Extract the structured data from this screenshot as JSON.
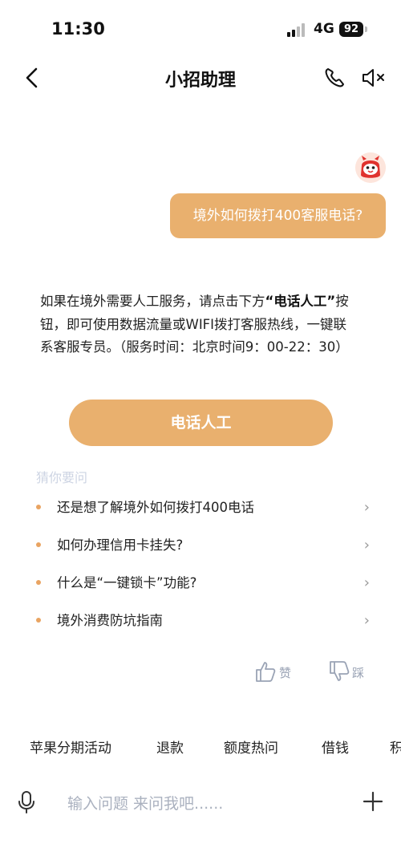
{
  "status_bar": {
    "time": "11:30",
    "network": "4G",
    "battery": "92"
  },
  "header": {
    "title": "小招助理"
  },
  "chat": {
    "user_message": "境外如何拨打400客服电话?",
    "answer_part1": "如果在境外需要人工服务，请点击下方",
    "answer_highlight": "“电话人工”",
    "answer_part2": "按钮，即可使用数据流量或WIFI拨打客服热线，一键联系客服专员。（服务时间：北京时间9：00-22：30）",
    "call_button": "电话人工"
  },
  "suggestions": {
    "title": "猜你要问",
    "items": [
      "还是想了解境外如何拨打400电话",
      "如何办理信用卡挂失?",
      "什么是“一键锁卡”功能?",
      "境外消费防坑指南"
    ]
  },
  "feedback": {
    "like": "赞",
    "dislike": "踩"
  },
  "quick_tags": [
    "苹果分期活动",
    "退款",
    "额度热问",
    "借钱",
    "积"
  ],
  "input": {
    "placeholder": "输入问题 来问我吧......"
  },
  "colors": {
    "accent": "#e9b06e",
    "dot": "#e9a462",
    "muted": "#cdd4e3"
  }
}
